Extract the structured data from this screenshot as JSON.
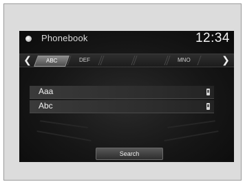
{
  "app": {
    "title": "Phonebook",
    "icon": "home-dot-icon",
    "clock": "12:34"
  },
  "tabs": [
    {
      "label": "ABC",
      "state": "active"
    },
    {
      "label": "DEF",
      "state": "normal"
    },
    {
      "label": "",
      "state": "dimmed"
    },
    {
      "label": "",
      "state": "dimmed"
    },
    {
      "label": "MNO",
      "state": "normal"
    }
  ],
  "nav": {
    "prev_icon": "chevron-left-icon",
    "next_icon": "chevron-right-icon"
  },
  "contacts": [
    {
      "name": "Aaa",
      "icon": "phone-icon"
    },
    {
      "name": "Abc",
      "icon": "phone-icon"
    }
  ],
  "search_label": "Search",
  "colors": {
    "screen_bg": "#161616",
    "text": "#f2f2f2",
    "active_tab": "#8a8a8a"
  }
}
